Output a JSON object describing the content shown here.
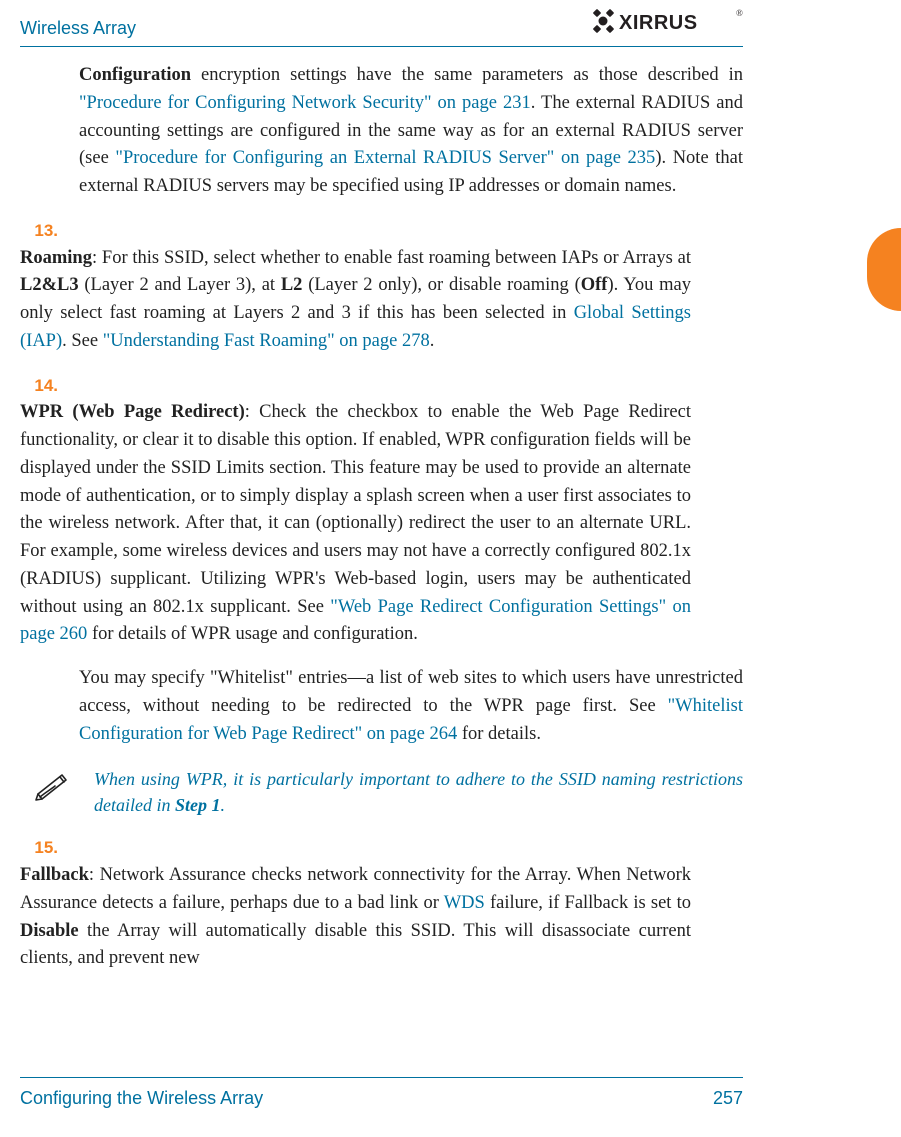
{
  "header": {
    "title": "Wireless Array",
    "brand": "XIRRUS"
  },
  "continued": {
    "lead_bold": "Configuration",
    "t1": " encryption settings have the same parameters as those described in ",
    "link1": "\"Procedure for Configuring Network Security\" on page 231",
    "t2": ". The external RADIUS and accounting settings are configured in the same way as for an external RADIUS server (see ",
    "link2": "\"Procedure for Configuring an External RADIUS Server\" on page 235",
    "t3": "). Note that external RADIUS servers may be specified using IP addresses or domain names."
  },
  "items": [
    {
      "num": "13.",
      "lead_bold": "Roaming",
      "t1": ": For this SSID, select whether to enable fast roaming between IAPs or Arrays at ",
      "b1": "L2&L3",
      "t2": " (Layer 2 and Layer 3), at ",
      "b2": "L2",
      "t3": " (Layer 2 only), or disable roaming (",
      "b3": "Off",
      "t4": "). You may only select fast roaming at Layers 2 and 3 if this has been selected in ",
      "link1": "Global Settings (IAP)",
      "t5": ". See ",
      "link2": "\"Understanding Fast Roaming\" on page 278",
      "t6": "."
    },
    {
      "num": "14.",
      "lead_bold": "WPR (Web Page Redirect)",
      "t1": ": Check the checkbox to enable the Web Page Redirect functionality, or clear it to disable this option. If enabled, WPR configuration fields will be displayed under the SSID Limits section. This feature may be used to provide an alternate mode of authentication, or to simply display a splash screen when a user first associates to the wireless network. After that, it can (optionally) redirect the user to an alternate URL. For example, some wireless devices and users may not have a correctly configured 802.1x (RADIUS) supplicant. Utilizing WPR's Web-based login, users may be authenticated without using an 802.1x supplicant. See ",
      "link1": "\"Web Page Redirect Configuration Settings\" on page 260",
      "t2": " for details of WPR usage and configuration.",
      "p2_t1": "You may specify \"Whitelist\" entries—a list of web sites to which users have unrestricted access, without needing to be redirected to the WPR page first. See ",
      "p2_link": "\"Whitelist Configuration for Web Page Redirect\" on page 264",
      "p2_t2": " for details."
    },
    {
      "num": "15.",
      "lead_bold": "Fallback",
      "t1": ": Network Assurance checks network connectivity for the Array. When Network Assurance detects a failure, perhaps due to a bad link or ",
      "link1": "WDS",
      "t2": " failure, if Fallback is set to ",
      "b1": "Disable",
      "t3": " the Array will automatically disable this SSID. This will disassociate current clients, and prevent new"
    }
  ],
  "note": {
    "t1": "When using WPR, it is particularly important to adhere to the SSID naming restrictions detailed in ",
    "step": "Step 1",
    "t2": "."
  },
  "footer": {
    "section": "Configuring the Wireless Array",
    "page": "257"
  }
}
